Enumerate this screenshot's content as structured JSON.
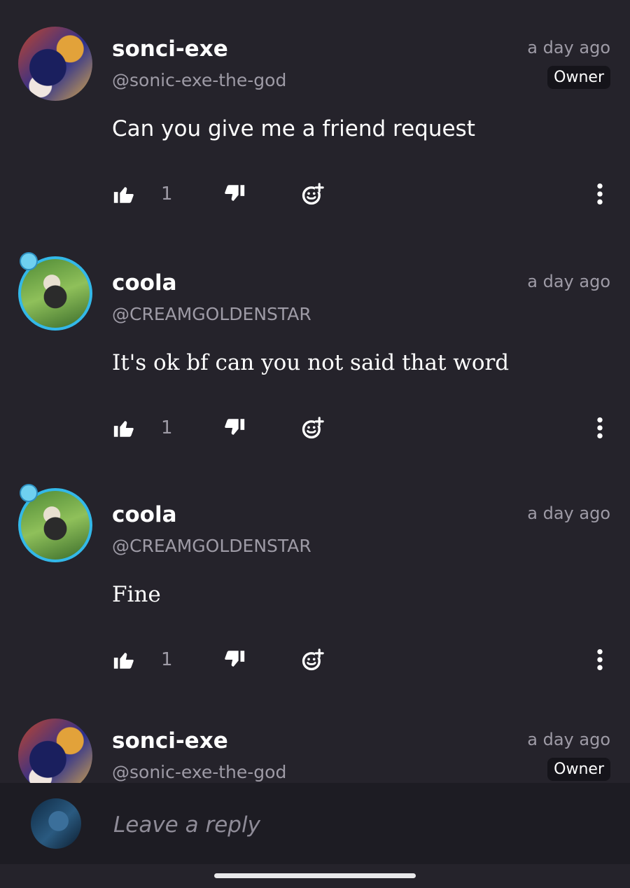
{
  "comments": [
    {
      "username": "sonci-exe",
      "handle": "@sonic-exe-the-god",
      "time": "a day ago",
      "badge": "Owner",
      "text": "Can you give me a friend request",
      "likes": "1",
      "avatar_style": "sonic"
    },
    {
      "username": "coola",
      "handle": "@CREAMGOLDENSTAR",
      "time": "a day ago",
      "text": "It's ok bf can you not said that word",
      "likes": "1",
      "avatar_style": "coola"
    },
    {
      "username": "coola",
      "handle": "@CREAMGOLDENSTAR",
      "time": "a day ago",
      "text": "Fine",
      "likes": "1",
      "avatar_style": "coola"
    },
    {
      "username": "sonci-exe",
      "handle": "@sonic-exe-the-god",
      "time": "a day ago",
      "badge": "Owner",
      "avatar_style": "sonic"
    }
  ],
  "reply": {
    "placeholder": "Leave a reply"
  },
  "icons": {
    "like": "thumbs-up-icon",
    "dislike": "thumbs-down-icon",
    "react": "add-reaction-icon",
    "more": "more-vertical-icon"
  },
  "colors": {
    "background": "#25232b",
    "reply_bar": "#1d1c23",
    "secondary_text": "#9e9ba6",
    "badge_bg": "#15141a"
  }
}
